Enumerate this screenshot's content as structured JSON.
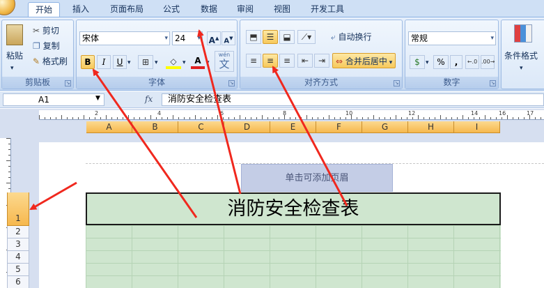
{
  "tabs": [
    "开始",
    "插入",
    "页面布局",
    "公式",
    "数据",
    "审阅",
    "视图",
    "开发工具"
  ],
  "clipboard": {
    "paste": "粘贴",
    "cut": "剪切",
    "copy": "复制",
    "format_painter": "格式刷",
    "label": "剪贴板"
  },
  "font": {
    "name": "宋体",
    "size": "24",
    "bold": "B",
    "italic": "I",
    "underline": "U",
    "font_color": "A",
    "phonetic": "wén",
    "phonetic_char": "文",
    "label": "字体"
  },
  "alignment": {
    "wrap_text": "自动换行",
    "merge_center": "合并后居中",
    "label": "对齐方式"
  },
  "number": {
    "format": "常规",
    "percent": "%",
    "comma": ",",
    "label": "数字"
  },
  "styles": {
    "conditional_format": "条件格式"
  },
  "formula_bar": {
    "name_box": "A1",
    "fx": "fx",
    "content": "消防安全检查表"
  },
  "ruler_numbers": [
    "2",
    "4",
    "6",
    "8",
    "10",
    "12",
    "14",
    "16",
    "17"
  ],
  "columns": [
    "A",
    "B",
    "C",
    "D",
    "E",
    "F",
    "G",
    "H",
    "I"
  ],
  "rows": [
    "1",
    "2",
    "3",
    "4",
    "5",
    "6"
  ],
  "sheet": {
    "header_placeholder": "单击可添加页眉",
    "title": "消防安全检查表"
  },
  "colors": {
    "accent": "#f6b84e",
    "annotation_arrow": "#f0281e",
    "title_fill": "#cfe6cf"
  }
}
